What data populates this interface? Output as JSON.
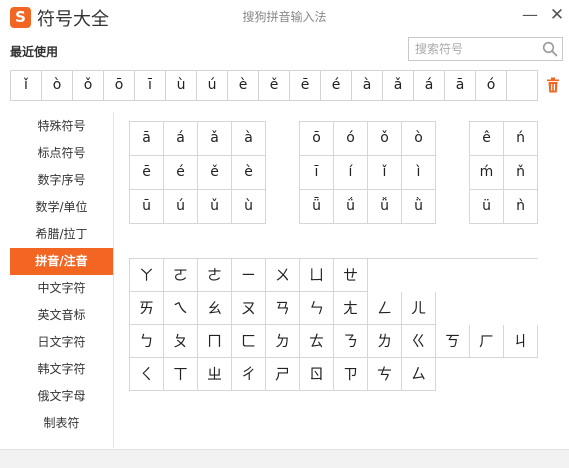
{
  "window": {
    "app_title": "符号大全",
    "ime_title": "搜狗拼音输入法",
    "logo_text": "S",
    "minimize_glyph": "—",
    "close_glyph": "✕"
  },
  "recent": {
    "label": "最近使用",
    "symbols": [
      "ǐ",
      "ò",
      "ǒ",
      "ō",
      "ī",
      "ù",
      "ú",
      "è",
      "ě",
      "ē",
      "é",
      "à",
      "ǎ",
      "á",
      "ā",
      "ó",
      ""
    ]
  },
  "search": {
    "placeholder": "搜索符号"
  },
  "sidebar": {
    "items": [
      {
        "label": "特殊符号",
        "active": false
      },
      {
        "label": "标点符号",
        "active": false
      },
      {
        "label": "数字序号",
        "active": false
      },
      {
        "label": "数学/单位",
        "active": false
      },
      {
        "label": "希腊/拉丁",
        "active": false
      },
      {
        "label": "拼音/注音",
        "active": true
      },
      {
        "label": "中文字符",
        "active": false
      },
      {
        "label": "英文音标",
        "active": false
      },
      {
        "label": "日文字符",
        "active": false
      },
      {
        "label": "韩文字符",
        "active": false
      },
      {
        "label": "俄文字母",
        "active": false
      },
      {
        "label": "制表符",
        "active": false
      }
    ]
  },
  "pinyin": {
    "group_a_e_u": [
      "ā",
      "á",
      "ǎ",
      "à",
      "ē",
      "é",
      "ě",
      "è",
      "ū",
      "ú",
      "ǔ",
      "ù"
    ],
    "group_o_i_v": [
      "ō",
      "ó",
      "ǒ",
      "ò",
      "ī",
      "í",
      "ǐ",
      "ì",
      "ǖ",
      "ǘ",
      "ǚ",
      "ǜ"
    ],
    "group_misc": [
      "ê",
      "ń",
      "ḿ",
      "ň",
      "ü",
      "ǹ"
    ]
  },
  "zhuyin": {
    "rows": [
      [
        "ㄚ",
        "ㄛ",
        "ㄜ",
        "ㄧ",
        "ㄨ",
        "ㄩ",
        "ㄝ"
      ],
      [
        "ㄞ",
        "ㄟ",
        "ㄠ",
        "ㄡ",
        "ㄢ",
        "ㄣ",
        "ㄤ",
        "ㄥ",
        "ㄦ"
      ],
      [
        "ㄅ",
        "ㄆ",
        "ㄇ",
        "ㄈ",
        "ㄉ",
        "ㄊ",
        "ㄋ",
        "ㄌ",
        "ㄍ",
        "ㄎ",
        "ㄏ",
        "ㄐ"
      ],
      [
        "ㄑ",
        "ㄒ",
        "ㄓ",
        "ㄔ",
        "ㄕ",
        "ㄖ",
        "ㄗ",
        "ㄘ",
        "ㄙ"
      ]
    ]
  },
  "colors": {
    "accent": "#f26522"
  }
}
